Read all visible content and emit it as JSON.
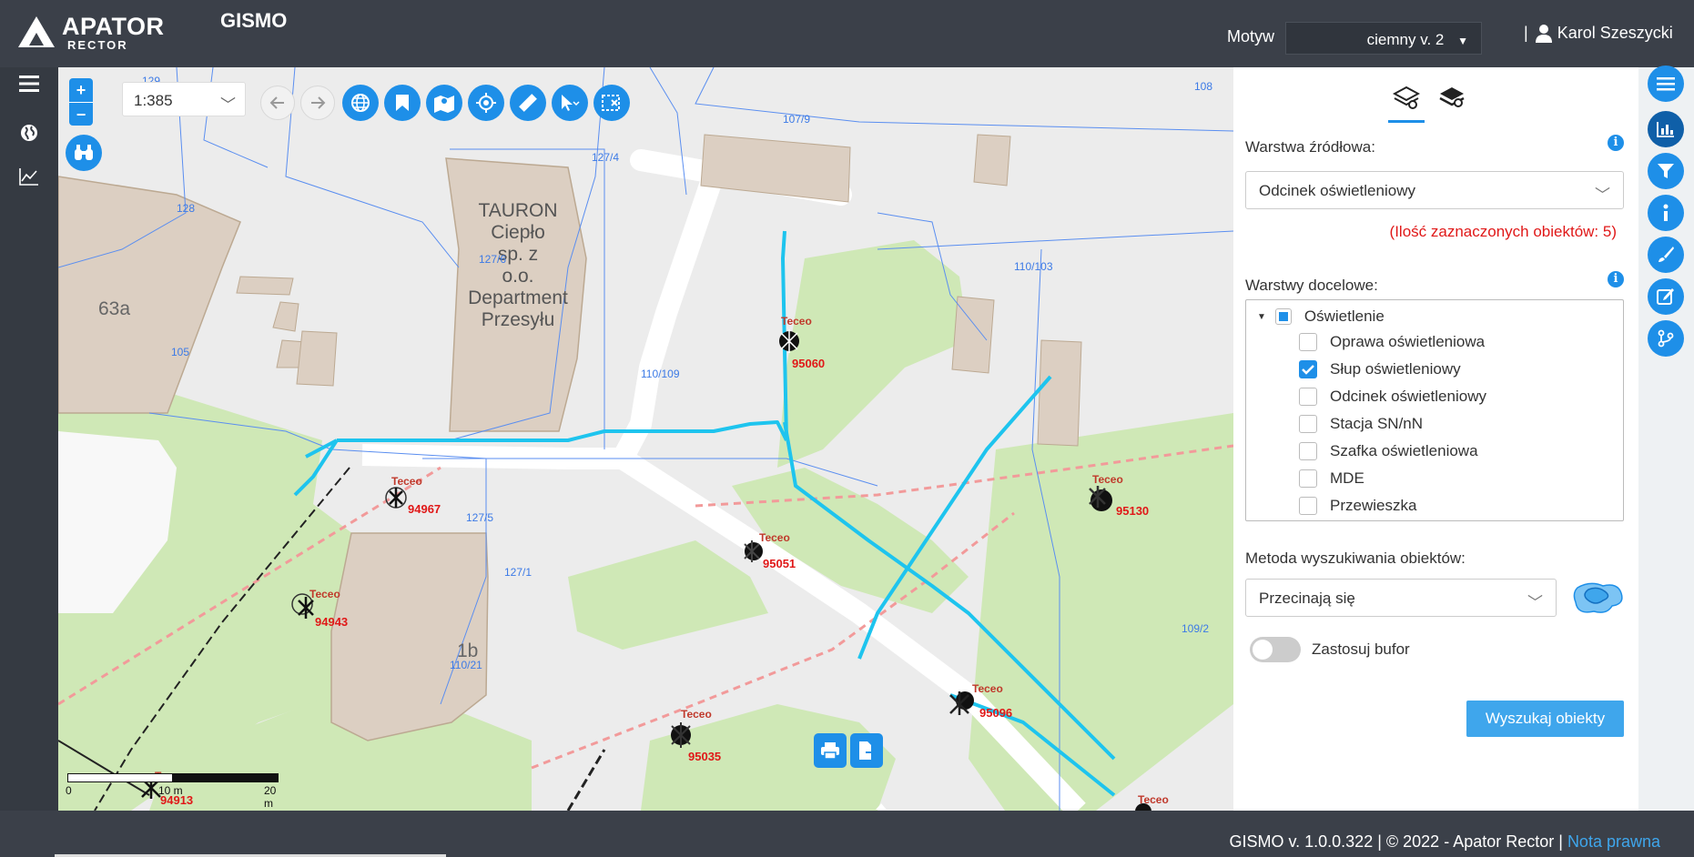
{
  "header": {
    "logo_main": "APATOR",
    "logo_sub": "RECTOR",
    "app_title": "GISMO",
    "theme_label": "Motyw",
    "theme_value": "ciemny v. 2",
    "user_name": "Karol Szeszycki"
  },
  "left_nav": {
    "icons": [
      "menu-icon",
      "globe-icon",
      "chart-line-icon"
    ]
  },
  "map": {
    "scale_value": "1:385",
    "zoom_in": "+",
    "zoom_out": "−",
    "scalebar": {
      "zero": "0",
      "mid": "10 m",
      "end": "20 m"
    },
    "buildings": [
      "TAURON",
      "Ciepło",
      "sp. z",
      "o.o.",
      "Department",
      "Przesyłu"
    ],
    "building_63a": "63a",
    "building_1b": "1b",
    "parcels": [
      "129",
      "107/9",
      "108",
      "127/4",
      "128",
      "127/6",
      "110/103",
      "105",
      "110/109",
      "127/5",
      "127/1",
      "110/21",
      "109/2"
    ],
    "objects": [
      {
        "label": "Teceo",
        "id": "95060"
      },
      {
        "label": "Teceo",
        "id": "94967"
      },
      {
        "label": "Teceo",
        "id": "95051"
      },
      {
        "label": "Teceo",
        "id": "95130"
      },
      {
        "label": "Teceo",
        "id": "94943"
      },
      {
        "label": "Teceo",
        "id": "95096"
      },
      {
        "label": "Teceo",
        "id": "95035"
      },
      {
        "label": "Teceo",
        "id": "94913"
      },
      {
        "label": "Teceo",
        "id": ""
      }
    ]
  },
  "panel": {
    "source_layer_label": "Warstwa źródłowa:",
    "source_layer_value": "Odcinek oświetleniowy",
    "selected_count": "(Ilość zaznaczonych obiektów: 5)",
    "target_layers_label": "Warstwy docelowe:",
    "tree": {
      "root": "Oświetlenie",
      "children": [
        {
          "label": "Oprawa oświetleniowa",
          "checked": false
        },
        {
          "label": "Słup oświetleniowy",
          "checked": true
        },
        {
          "label": "Odcinek oświetleniowy",
          "checked": false
        },
        {
          "label": "Stacja SN/nN",
          "checked": false
        },
        {
          "label": "Szafka oświetleniowa",
          "checked": false
        },
        {
          "label": "MDE",
          "checked": false
        },
        {
          "label": "Przewieszka",
          "checked": false
        }
      ]
    },
    "method_label": "Metoda wyszukiwania obiektów:",
    "method_value": "Przecinają się",
    "buffer_label": "Zastosuj bufor",
    "search_button": "Wyszukaj obiekty"
  },
  "footer": {
    "version_text": "GISMO v. 1.0.0.322 | © 2022 - Apator Rector |",
    "legal_link": "Nota prawna"
  },
  "colors": {
    "accent": "#1e8fe8",
    "topbar": "#3b4049",
    "error": "#e01818",
    "cable": "#1ec4ee"
  }
}
